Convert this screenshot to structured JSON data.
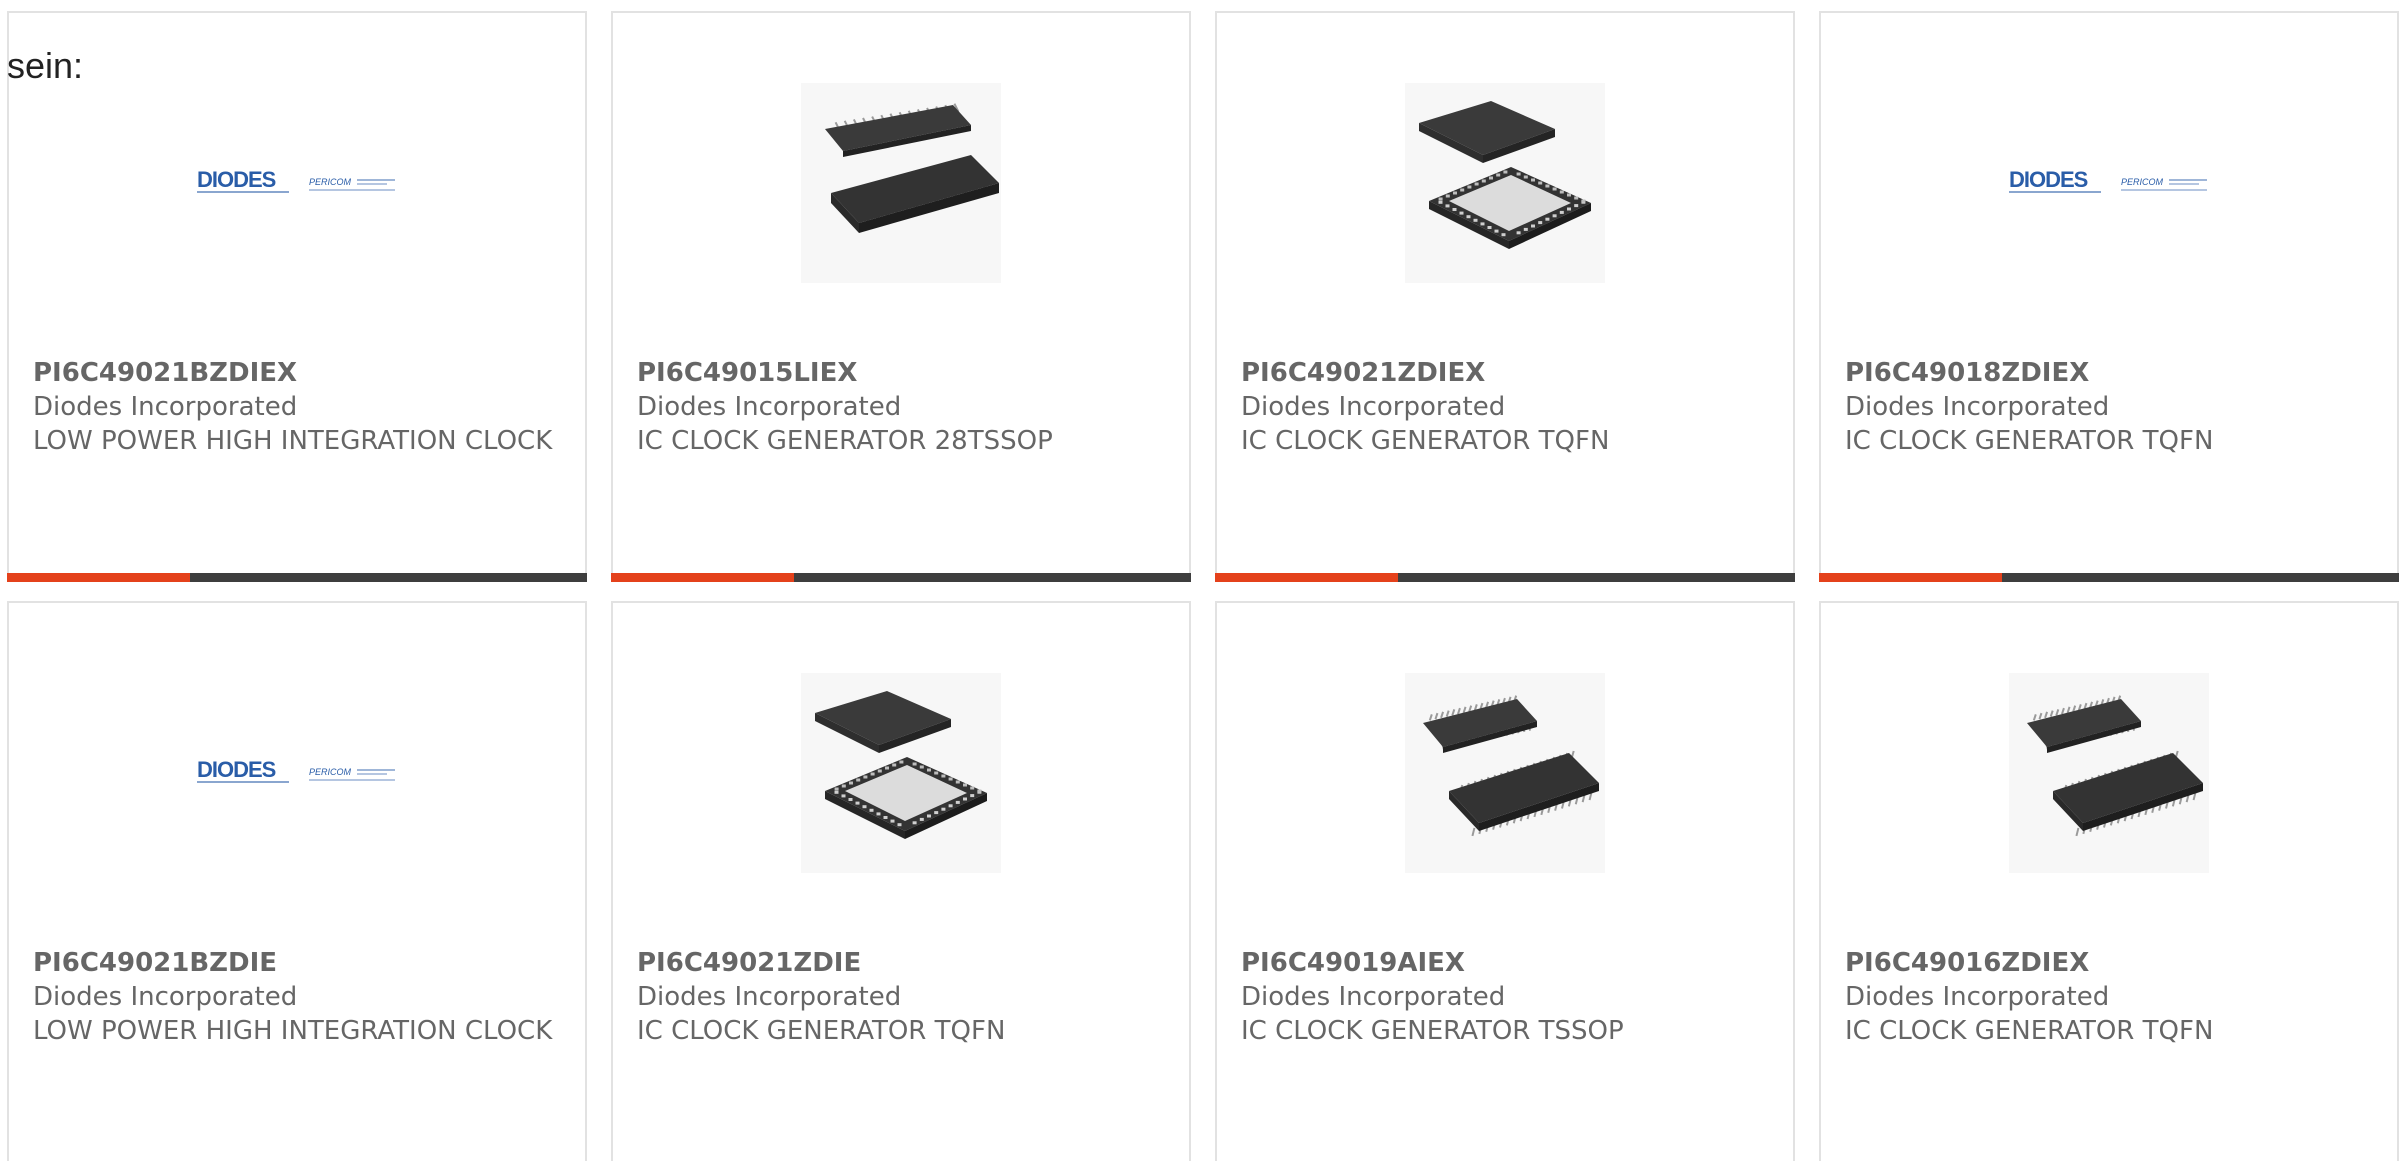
{
  "intro_text": "sein:",
  "colors": {
    "accent": "#e4411b",
    "bar": "#3e3e3e",
    "text": "#666666",
    "border": "#e2e2e2",
    "logo_blue": "#2a5da8"
  },
  "cards": [
    {
      "part": "PI6C49021BZDIEX",
      "manufacturer": "Diodes Incorporated",
      "description": "LOW POWER HIGH INTEGRATION CLOCK",
      "image_icon": "diodes-pericom-logo",
      "logo_main": "DIODES",
      "logo_sub": "PERICOM",
      "show_bar": true
    },
    {
      "part": "PI6C49015LIEX",
      "manufacturer": "Diodes Incorporated",
      "description": "IC CLOCK GENERATOR 28TSSOP",
      "image_icon": "tssop-chip-icon",
      "show_bar": true
    },
    {
      "part": "PI6C49021ZDIEX",
      "manufacturer": "Diodes Incorporated",
      "description": "IC CLOCK GENERATOR TQFN",
      "image_icon": "tqfn-chip-icon",
      "show_bar": true
    },
    {
      "part": "PI6C49018ZDIEX",
      "manufacturer": "Diodes Incorporated",
      "description": "IC CLOCK GENERATOR TQFN",
      "image_icon": "diodes-pericom-logo",
      "logo_main": "DIODES",
      "logo_sub": "PERICOM",
      "show_bar": true
    },
    {
      "part": "PI6C49021BZDIE",
      "manufacturer": "Diodes Incorporated",
      "description": "LOW POWER HIGH INTEGRATION CLOCK",
      "image_icon": "diodes-pericom-logo",
      "logo_main": "DIODES",
      "logo_sub": "PERICOM",
      "show_bar": false
    },
    {
      "part": "PI6C49021ZDIE",
      "manufacturer": "Diodes Incorporated",
      "description": "IC CLOCK GENERATOR TQFN",
      "image_icon": "tqfn-chip-icon",
      "show_bar": false
    },
    {
      "part": "PI6C49019AIEX",
      "manufacturer": "Diodes Incorporated",
      "description": "IC CLOCK GENERATOR TSSOP",
      "image_icon": "ssop-chip-icon",
      "show_bar": false
    },
    {
      "part": "PI6C49016ZDIEX",
      "manufacturer": "Diodes Incorporated",
      "description": "IC CLOCK GENERATOR TQFN",
      "image_icon": "ssop-chip-icon",
      "show_bar": false
    }
  ]
}
